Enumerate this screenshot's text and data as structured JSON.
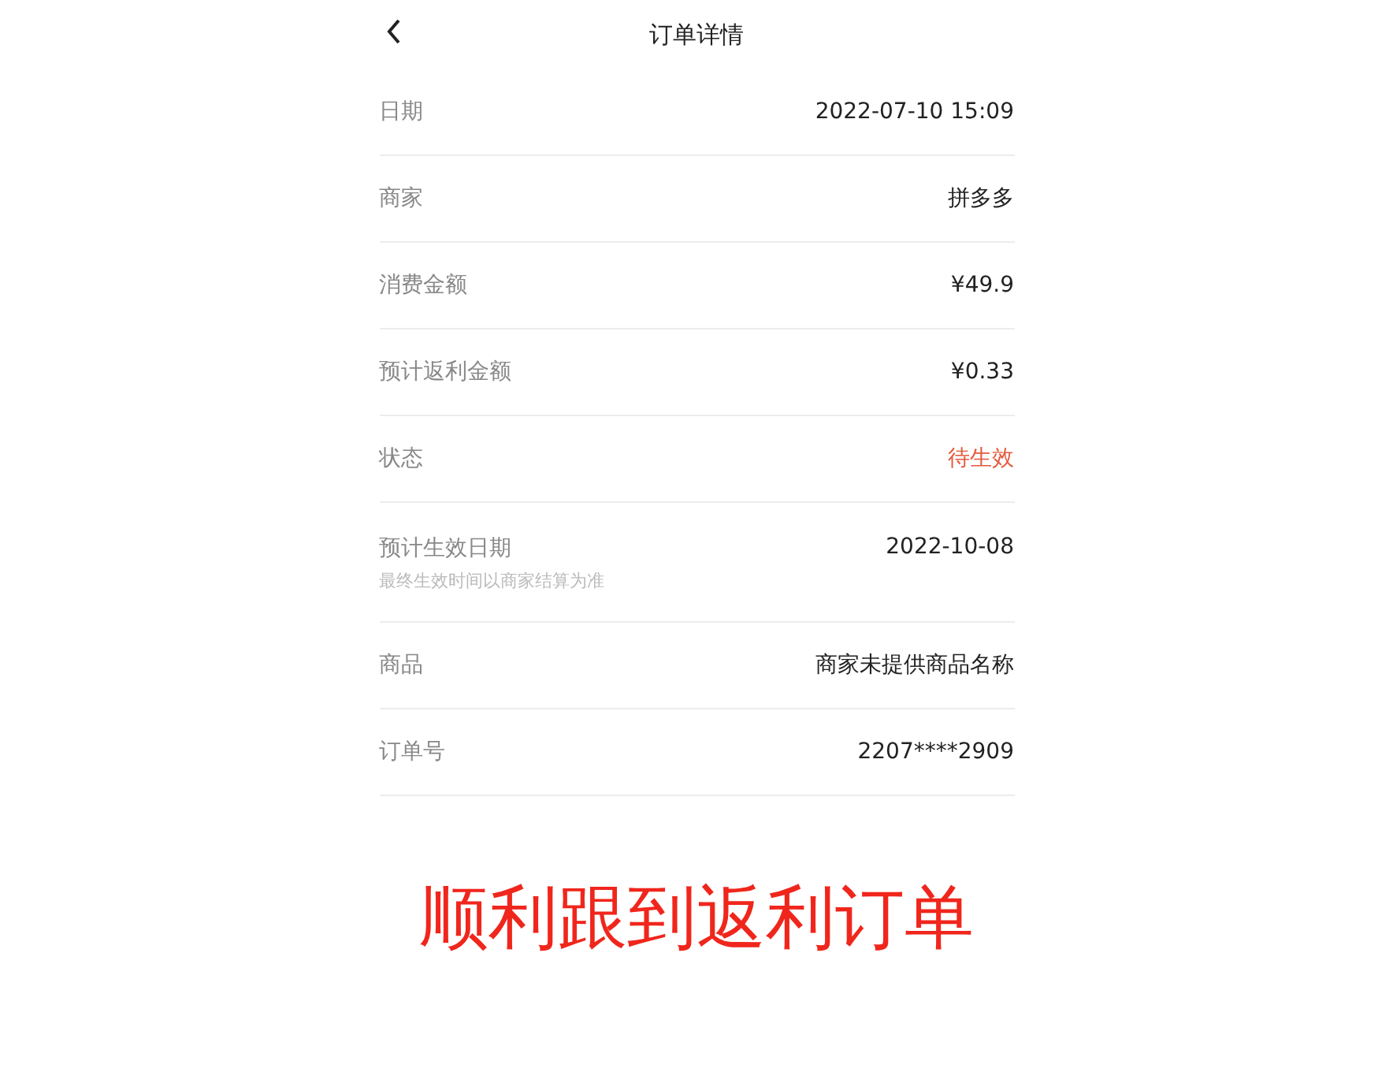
{
  "header": {
    "title": "订单详情"
  },
  "rows": [
    {
      "label": "日期",
      "value": "2022-07-10 15:09",
      "highlighted": false
    },
    {
      "label": "商家",
      "value": "拼多多",
      "highlighted": false
    },
    {
      "label": "消费金额",
      "value": "¥49.9",
      "highlighted": false
    },
    {
      "label": "预计返利金额",
      "value": "¥0.33",
      "highlighted": false
    },
    {
      "label": "状态",
      "value": "待生效",
      "highlighted": true
    },
    {
      "label": "预计生效日期",
      "value": "2022-10-08",
      "note": "最终生效时间以商家结算为准",
      "highlighted": false
    },
    {
      "label": "商品",
      "value": "商家未提供商品名称",
      "highlighted": false
    },
    {
      "label": "订单号",
      "value": "2207****2909",
      "highlighted": false
    }
  ],
  "caption": "顺利跟到返利订单"
}
